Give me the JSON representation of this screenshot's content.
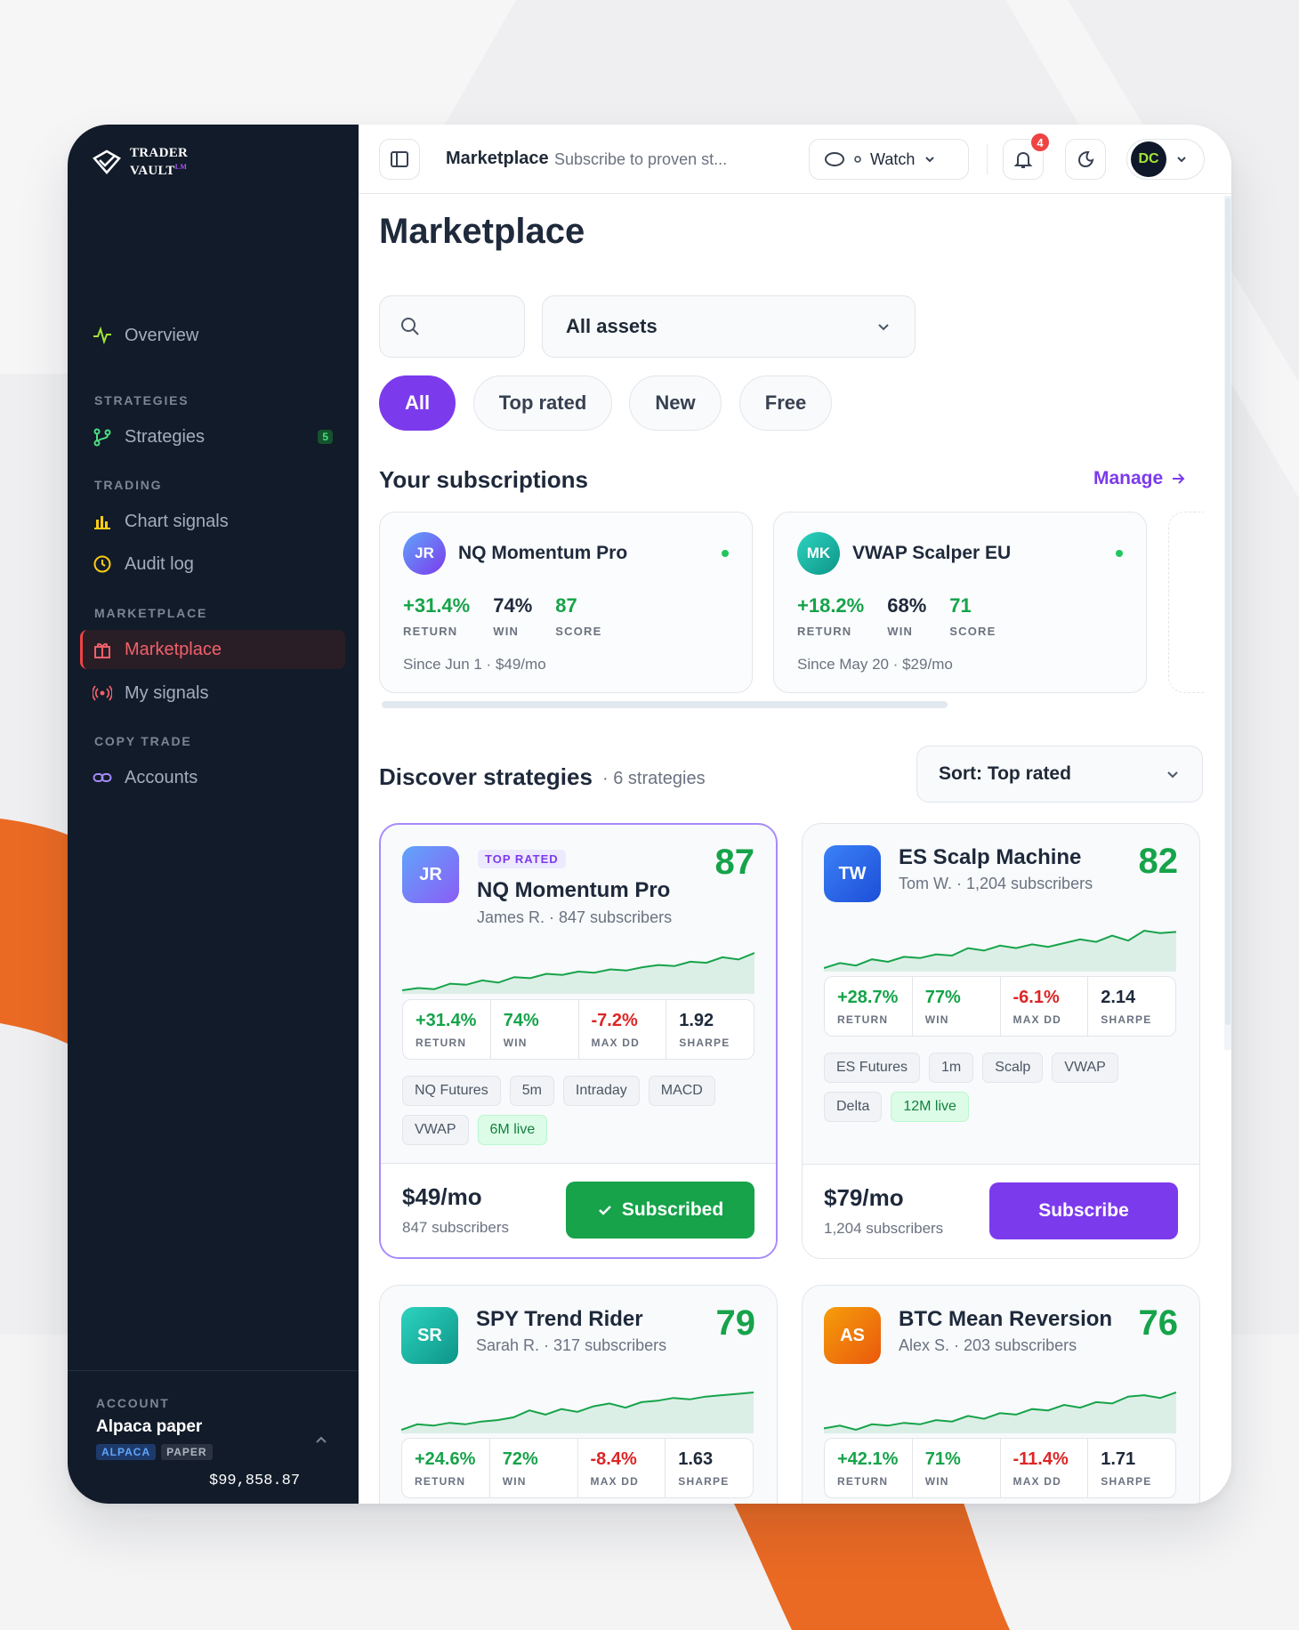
{
  "brand": {
    "line1": "TRADER",
    "line2": "VAULT",
    "mark": "LM"
  },
  "sidebar": {
    "overview": "Overview",
    "sections": {
      "strategies": "STRATEGIES",
      "trading": "TRADING",
      "marketplace": "MARKETPLACE",
      "copy_trade": "COPY TRADE"
    },
    "items": {
      "strategies": "Strategies",
      "strategies_badge": "5",
      "chart_signals": "Chart signals",
      "audit_log": "Audit log",
      "marketplace": "Marketplace",
      "my_signals": "My signals",
      "accounts": "Accounts"
    },
    "account": {
      "label": "ACCOUNT",
      "name": "Alpaca paper",
      "tag1": "ALPACA",
      "tag2": "PAPER",
      "balance": "$99,858.87"
    }
  },
  "topbar": {
    "crumb": "Marketplace",
    "crumb_sub": "Subscribe to proven st...",
    "watch": "Watch",
    "notifications": "4",
    "avatar": "DC"
  },
  "page": {
    "title": "Marketplace",
    "asset_filter": "All assets",
    "pills": [
      "All",
      "Top rated",
      "New",
      "Free"
    ],
    "subs_title": "Your subscriptions",
    "manage": "Manage",
    "discover_title": "Discover strategies",
    "discover_count": "· 6 strategies",
    "sort": "Sort: Top rated"
  },
  "subscriptions": [
    {
      "initials": "JR",
      "name": "NQ Momentum Pro",
      "ret": "+31.4%",
      "win": "74%",
      "score": "87",
      "ret_l": "RETURN",
      "win_l": "WIN",
      "score_l": "SCORE",
      "since": "Since Jun 1 · $49/mo"
    },
    {
      "initials": "MK",
      "name": "VWAP Scalper EU",
      "ret": "+18.2%",
      "win": "68%",
      "score": "71",
      "ret_l": "RETURN",
      "win_l": "WIN",
      "score_l": "SCORE",
      "since": "Since May 20 · $29/mo"
    }
  ],
  "strategies": [
    {
      "initials": "JR",
      "badge": "TOP RATED",
      "name": "NQ Momentum Pro",
      "meta": "James R. · 847 subscribers",
      "score": "87",
      "ret": "+31.4%",
      "win": "74%",
      "dd": "-7.2%",
      "sharpe": "1.92",
      "chips": [
        "NQ Futures",
        "5m",
        "Intraday",
        "MACD",
        "VWAP"
      ],
      "live": "6M live",
      "price": "$49/mo",
      "subs": "847 subscribers",
      "cta": "Subscribed",
      "spark": [
        10,
        12,
        11,
        16,
        15,
        19,
        17,
        22,
        21,
        25,
        24,
        27,
        26,
        29,
        28,
        31,
        33,
        32,
        36,
        35,
        40,
        38,
        44
      ]
    },
    {
      "initials": "TW",
      "name": "ES Scalp Machine",
      "meta": "Tom W. · 1,204 subscribers",
      "score": "82",
      "ret": "+28.7%",
      "win": "77%",
      "dd": "-6.1%",
      "sharpe": "2.14",
      "chips": [
        "ES Futures",
        "1m",
        "Scalp",
        "VWAP",
        "Delta"
      ],
      "live": "12M live",
      "price": "$79/mo",
      "subs": "1,204 subscribers",
      "cta": "Subscribe",
      "spark": [
        10,
        14,
        12,
        17,
        15,
        19,
        18,
        21,
        20,
        26,
        24,
        28,
        26,
        29,
        27,
        30,
        33,
        31,
        36,
        32,
        40,
        38,
        39
      ]
    },
    {
      "initials": "SR",
      "name": "SPY Trend Rider",
      "meta": "Sarah R. · 317 subscribers",
      "score": "79",
      "ret": "+24.6%",
      "win": "72%",
      "dd": "-8.4%",
      "sharpe": "1.63",
      "spark": [
        8,
        12,
        11,
        13,
        12,
        14,
        15,
        17,
        22,
        19,
        23,
        21,
        25,
        27,
        24,
        28,
        29,
        31,
        30,
        32,
        33,
        34,
        35
      ]
    },
    {
      "initials": "AS",
      "name": "BTC Mean Reversion",
      "meta": "Alex S. · 203 subscribers",
      "score": "76",
      "ret": "+42.1%",
      "win": "71%",
      "dd": "-11.4%",
      "sharpe": "1.71",
      "spark": [
        8,
        10,
        7,
        11,
        10,
        12,
        11,
        14,
        13,
        17,
        15,
        19,
        18,
        22,
        21,
        25,
        23,
        27,
        26,
        31,
        32,
        30,
        34
      ]
    }
  ],
  "labels": {
    "ret": "RETURN",
    "win": "WIN",
    "dd": "MAX DD",
    "sharpe": "SHARPE"
  },
  "colors": {
    "accent": "#7c3aed",
    "positive": "#16a34a",
    "negative": "#dc2626",
    "sidebar": "#121b29",
    "orange": "#ea6a24"
  }
}
